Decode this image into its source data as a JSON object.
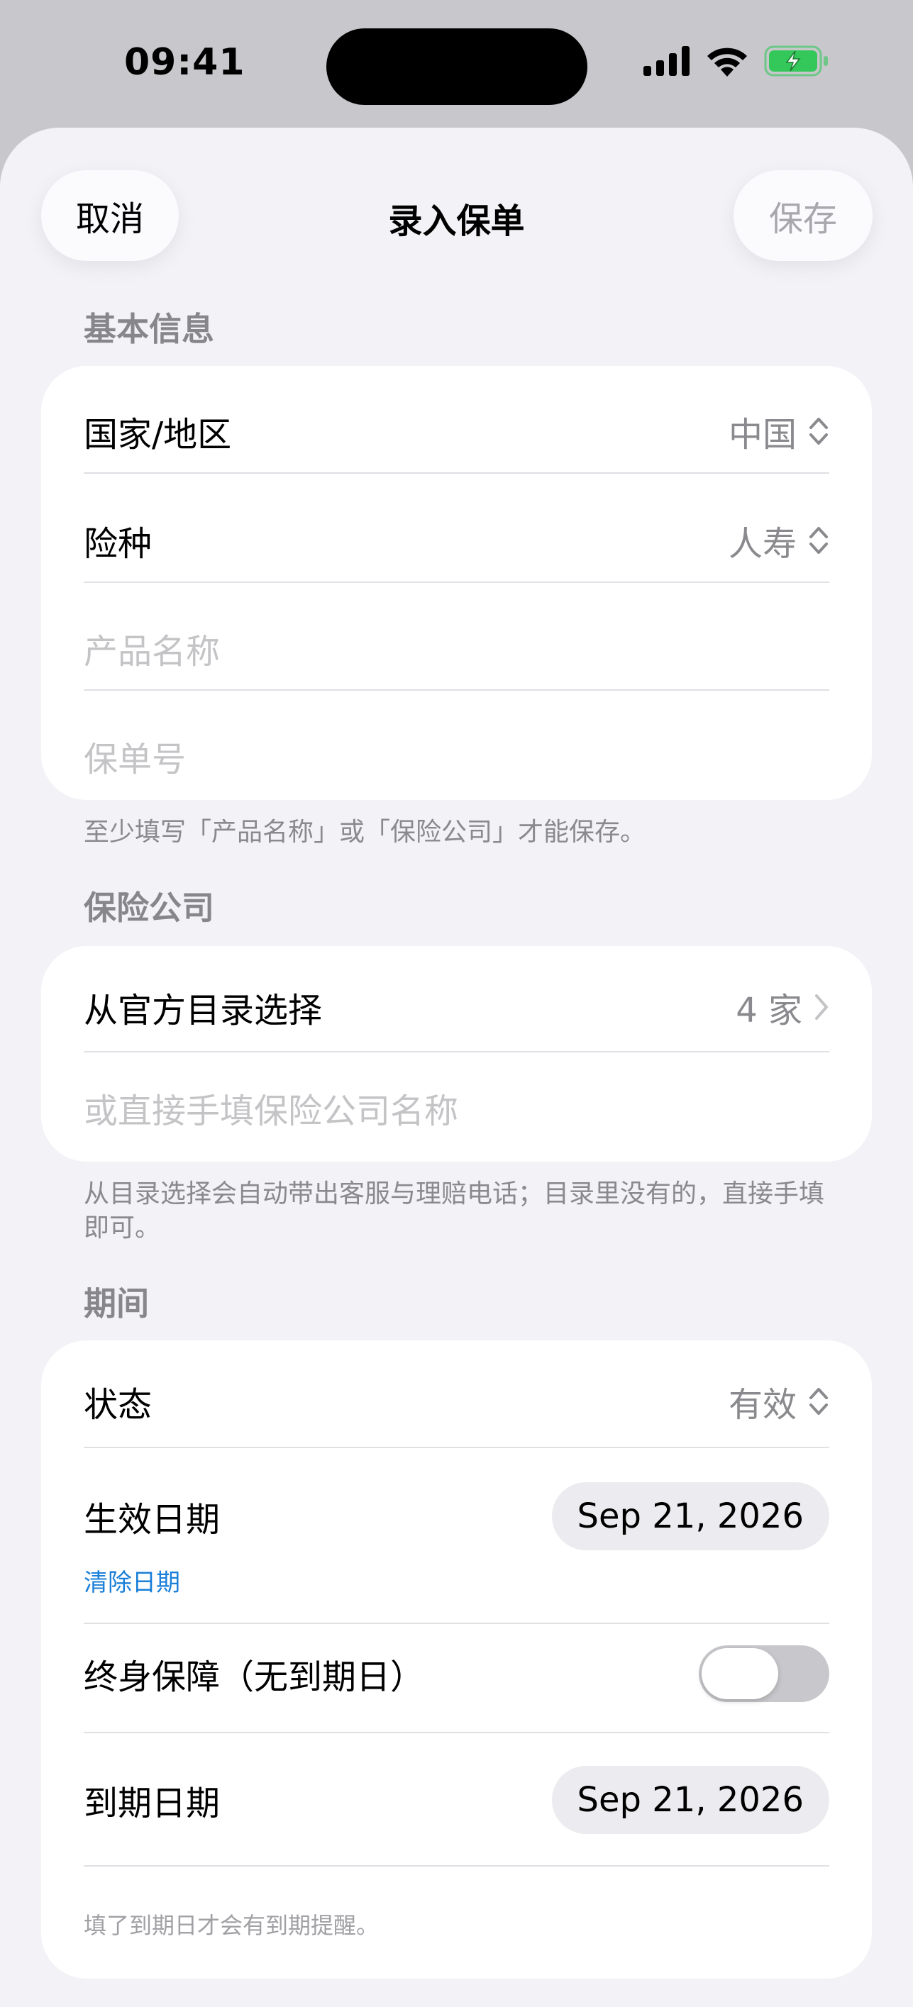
{
  "status_bar": {
    "time": "09:41"
  },
  "nav": {
    "cancel": "取消",
    "title": "录入保单",
    "save": "保存"
  },
  "basic": {
    "header": "基本信息",
    "country_label": "国家/地区",
    "country_value": "中国",
    "type_label": "险种",
    "type_value": "人寿",
    "product_placeholder": "产品名称",
    "policy_placeholder": "保单号",
    "footer": "至少填写「产品名称」或「保险公司」才能保存。"
  },
  "insurer": {
    "header": "保险公司",
    "catalog_label": "从官方目录选择",
    "catalog_value": "4 家",
    "manual_placeholder": "或直接手填保险公司名称",
    "footer": "从目录选择会自动带出客服与理赔电话；目录里没有的，直接手填即可。"
  },
  "period": {
    "header": "期间",
    "status_label": "状态",
    "status_value": "有效",
    "start_label": "生效日期",
    "start_value": "Sep 21, 2026",
    "clear_date": "清除日期",
    "lifetime_label": "终身保障（无到期日）",
    "lifetime_on": false,
    "end_label": "到期日期",
    "end_value": "Sep 21, 2026",
    "note": "填了到期日才会有到期提醒。"
  },
  "colors": {
    "accent_link": "#1a7fd8",
    "battery_green": "#34c759"
  }
}
